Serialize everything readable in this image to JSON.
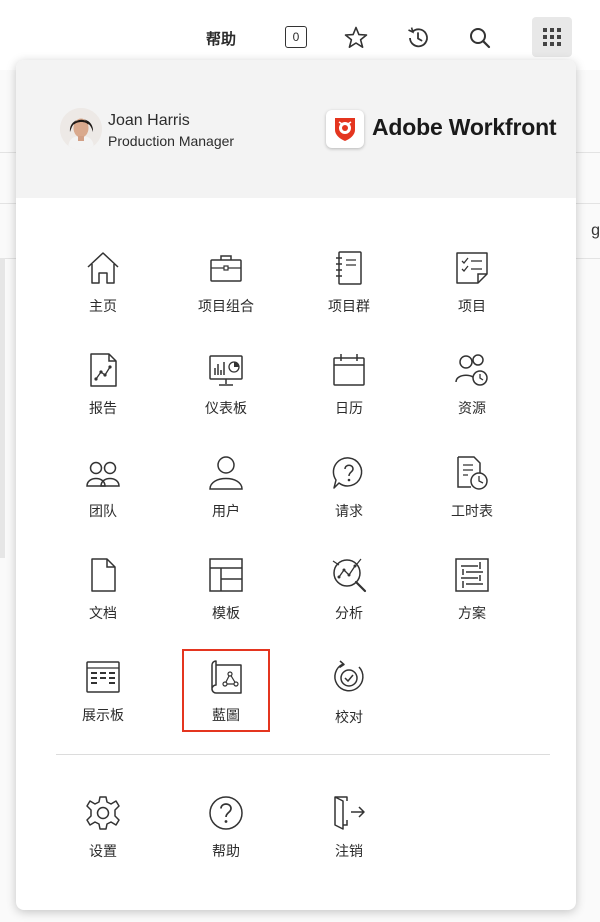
{
  "topbar": {
    "help_label": "帮助",
    "notification_count": "0",
    "icons": [
      "star-icon",
      "history-icon",
      "search-icon",
      "apps-grid-icon"
    ]
  },
  "background": {
    "fragment": "g"
  },
  "user": {
    "name": "Joan Harris",
    "role": "Production Manager"
  },
  "brand": {
    "name": "Adobe Workfront",
    "color": "#e4351f"
  },
  "menu_items": [
    {
      "label": "主页",
      "icon": "home-icon"
    },
    {
      "label": "项目组合",
      "icon": "briefcase-icon"
    },
    {
      "label": "项目群",
      "icon": "notebook-icon"
    },
    {
      "label": "项目",
      "icon": "checklist-icon"
    },
    {
      "label": "报告",
      "icon": "report-icon"
    },
    {
      "label": "仪表板",
      "icon": "dashboard-icon"
    },
    {
      "label": "日历",
      "icon": "calendar-icon"
    },
    {
      "label": "资源",
      "icon": "resources-icon"
    },
    {
      "label": "团队",
      "icon": "team-icon"
    },
    {
      "label": "用户",
      "icon": "user-icon"
    },
    {
      "label": "请求",
      "icon": "request-icon"
    },
    {
      "label": "工时表",
      "icon": "timesheet-icon"
    },
    {
      "label": "文档",
      "icon": "document-icon"
    },
    {
      "label": "模板",
      "icon": "template-icon"
    },
    {
      "label": "分析",
      "icon": "analytics-icon"
    },
    {
      "label": "方案",
      "icon": "scenario-icon"
    },
    {
      "label": "展示板",
      "icon": "board-icon"
    },
    {
      "label": "藍圖",
      "icon": "blueprint-icon",
      "highlighted": true
    },
    {
      "label": "校对",
      "icon": "proof-icon"
    }
  ],
  "footer_items": [
    {
      "label": "设置",
      "icon": "gear-icon"
    },
    {
      "label": "帮助",
      "icon": "help-icon"
    },
    {
      "label": "注销",
      "icon": "logout-icon"
    }
  ],
  "colors": {
    "accent": "#e4351f",
    "icon_stroke": "#333333",
    "header_bg": "#f3f3f3"
  }
}
